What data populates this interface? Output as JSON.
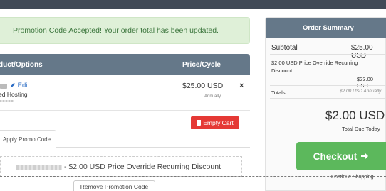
{
  "alert": {
    "message": "Promotion Code Accepted! Your order total has been updated."
  },
  "cart": {
    "header": {
      "product_col": "duct/Options",
      "price_col": "Price/Cycle"
    },
    "item": {
      "edit_label": "Edit",
      "name": "ed Hosting",
      "price": "$25.00 USD",
      "cycle": "Annually",
      "remove_label": "×"
    },
    "empty_cart_label": "Empty Cart"
  },
  "promo": {
    "tab_label": "Apply Promo Code",
    "applied_text": "- $2.00 USD Price Override Recurring Discount",
    "remove_label": "Remove Promotion Code"
  },
  "summary": {
    "title": "Order Summary",
    "subtotal_label": "Subtotal",
    "subtotal_value": "$25.00 USD",
    "override_label": "$2.00 USD Price Override Recurring Discount",
    "override_value": "$23.00 USD",
    "totals_label": "Totals",
    "totals_value": "$2.00 USD Annually",
    "total_due": "$2.00 USD",
    "total_due_label": "Total Due Today",
    "checkout_label": "Checkout",
    "continue_label": "Continue Shopping"
  },
  "colors": {
    "header_bg": "#657889",
    "alert_bg": "#dff0d8",
    "alert_text": "#3c763d",
    "danger": "#e53935",
    "success": "#5cb85c",
    "link": "#2b6cc4"
  },
  "icons": [
    "pencil-icon",
    "trash-icon",
    "arrow-right-icon",
    "close-icon"
  ]
}
